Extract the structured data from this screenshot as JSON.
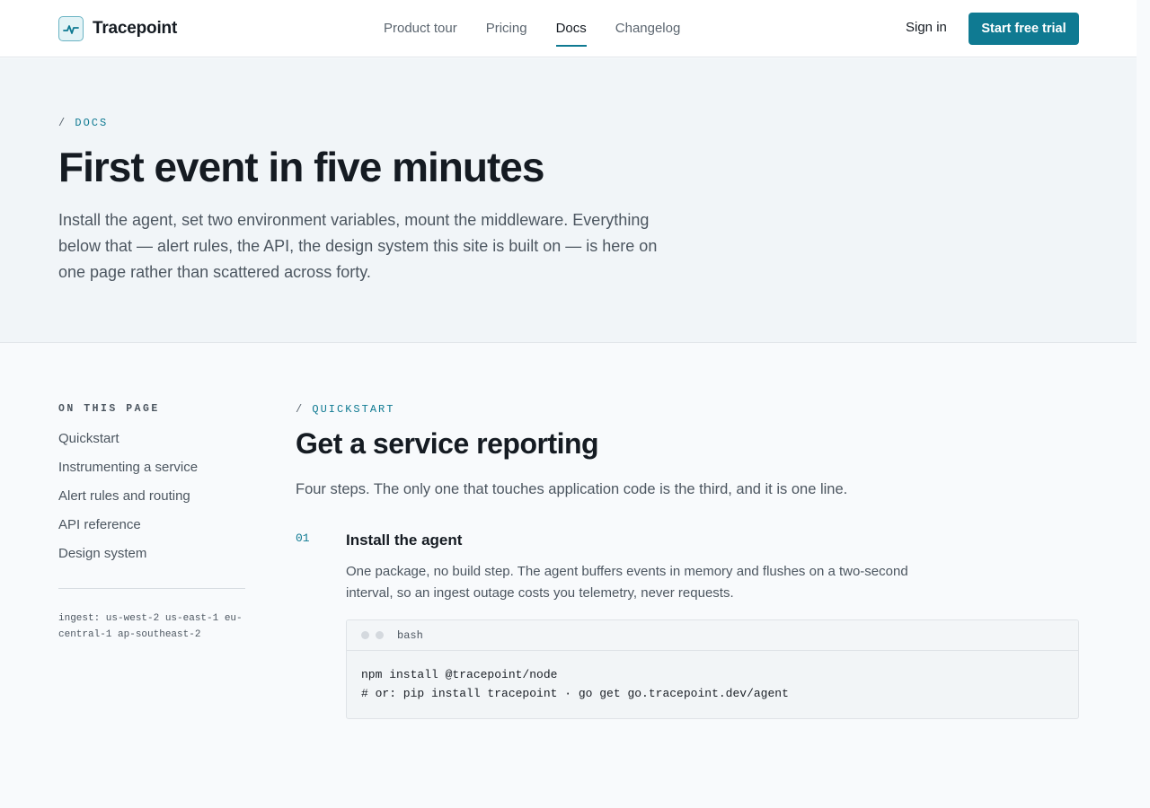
{
  "header": {
    "brand": "Tracepoint",
    "nav": [
      {
        "label": "Product tour",
        "active": false
      },
      {
        "label": "Pricing",
        "active": false
      },
      {
        "label": "Docs",
        "active": true
      },
      {
        "label": "Changelog",
        "active": false
      }
    ],
    "sign_in": "Sign in",
    "cta": "Start free trial"
  },
  "hero": {
    "eyebrow_slash": "/",
    "eyebrow": "DOCS",
    "title": "First event in five minutes",
    "lead": "Install the agent, set two environment variables, mount the middleware. Everything below that — alert rules, the API, the design system this site is built on — is here on one page rather than scattered across forty."
  },
  "sidebar": {
    "heading": "ON THIS PAGE",
    "items": [
      "Quickstart",
      "Instrumenting a service",
      "Alert rules and routing",
      "API reference",
      "Design system"
    ],
    "regions": "ingest: us-west-2 us-east-1 eu-central-1 ap-southeast-2"
  },
  "main": {
    "eyebrow_slash": "/",
    "eyebrow": "QUICKSTART",
    "title": "Get a service reporting",
    "lead": "Four steps. The only one that touches application code is the third, and it is one line.",
    "step": {
      "number": "01",
      "title": "Install the agent",
      "body": "One package, no build step. The agent buffers events in memory and flushes on a two-second interval, so an ingest outage costs you telemetry, never requests.",
      "code": {
        "lang": "bash",
        "lines": [
          "npm install @tracepoint/node",
          "# or: pip install tracepoint · go get go.tracepoint.dev/agent"
        ]
      }
    }
  },
  "colors": {
    "accent": "#0f7a92",
    "text": "#151b22",
    "muted": "#4c5660",
    "hero_bg": "#f1f5f8"
  }
}
